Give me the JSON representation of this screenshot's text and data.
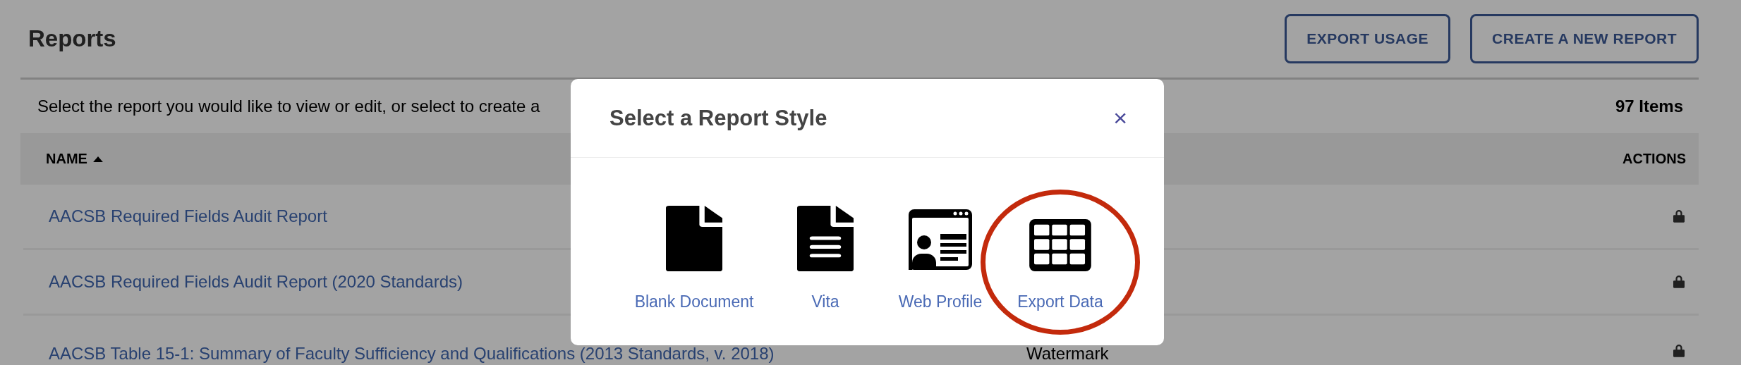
{
  "page": {
    "title": "Reports",
    "buttons": [
      "EXPORT USAGE",
      "CREATE A NEW REPORT"
    ],
    "description": "Select the report you would like to view or edit, or select to create a",
    "count": "97 Items"
  },
  "table": {
    "columns": [
      {
        "label": "NAME",
        "sorted": true
      },
      {
        "label": "ACTIONS"
      }
    ],
    "rows": [
      {
        "name": "AACSB Required Fields Audit Report",
        "locked": true
      },
      {
        "name": "AACSB Required Fields Audit Report (2020 Standards)",
        "locked": true
      },
      {
        "name": "AACSB Table 15-1: Summary of Faculty Sufficiency and Qualifications (2013 Standards, v. 2018)",
        "column_2": "Watermark",
        "locked": true
      }
    ]
  },
  "modal": {
    "title": "Select a Report Style",
    "close": "×",
    "items": [
      {
        "kind": "blank",
        "label": "Blank Document",
        "highlighted": false
      },
      {
        "kind": "vita",
        "label": "Vita",
        "highlighted": false
      },
      {
        "kind": "web-profile",
        "label": "Web Profile",
        "highlighted": false
      },
      {
        "kind": "export",
        "label": "Export Data",
        "highlighted": true
      }
    ]
  }
}
